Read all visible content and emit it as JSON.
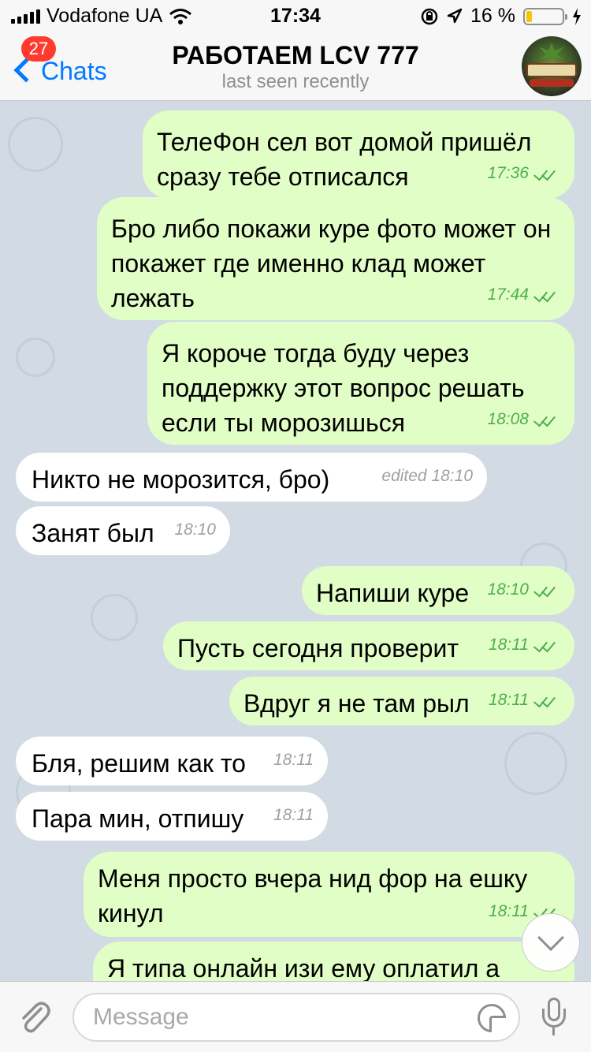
{
  "status_bar": {
    "carrier": "Vodafone UA",
    "time": "17:34",
    "battery": "16 %",
    "battery_level": 0.16
  },
  "header": {
    "back_label": "Chats",
    "unread_badge": "27",
    "title": "РАБОТАЕМ LCV 777",
    "subtitle": "last seen recently",
    "avatar_text": "BOSSCO"
  },
  "messages": [
    {
      "dir": "out",
      "text": "ТелеФон сел вот домой пришёл сразу тебе отписался",
      "time": "17:36"
    },
    {
      "dir": "out",
      "text": "Бро либо покажи куре фото может он покажет где именно клад может лежать",
      "time": "17:44"
    },
    {
      "dir": "out",
      "text": "Я короче тогда буду через поддержку этот вопрос решать если ты морозишься",
      "time": "18:08"
    },
    {
      "dir": "in",
      "text": "Никто не морозится, бро)",
      "time": "edited 18:10"
    },
    {
      "dir": "in",
      "text": "Занят был",
      "time": "18:10"
    },
    {
      "dir": "out",
      "text": "Напиши куре",
      "time": "18:10"
    },
    {
      "dir": "out",
      "text": "Пусть сегодня проверит",
      "time": "18:11"
    },
    {
      "dir": "out",
      "text": "Вдруг я не там рыл",
      "time": "18:11"
    },
    {
      "dir": "in",
      "text": "Бля, решим как то",
      "time": "18:11"
    },
    {
      "dir": "in",
      "text": "Пара мин, отпишу",
      "time": "18:11"
    },
    {
      "dir": "out",
      "text": "Меня просто вчера нид фор на ешку кинул",
      "time": "18:11"
    },
    {
      "dir": "out",
      "text": "Я типа онлайн изи ему оплатил а",
      "time": ""
    }
  ],
  "input": {
    "placeholder": "Message"
  },
  "colors": {
    "accent": "#007aff",
    "outgoing": "#e1fec6",
    "incoming": "#ffffff",
    "badge": "#ff3b30",
    "read_check": "#4fae4e"
  }
}
